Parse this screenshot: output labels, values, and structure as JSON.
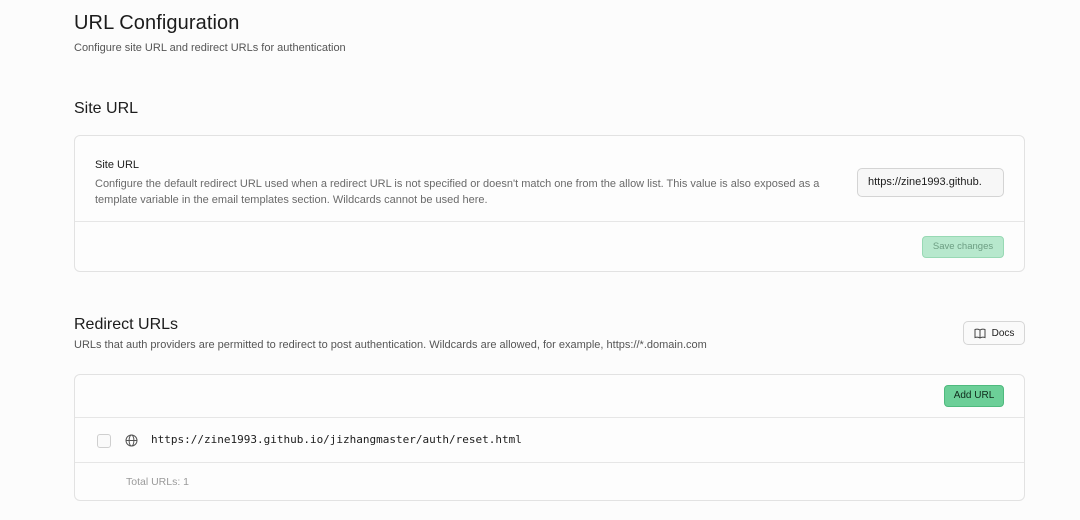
{
  "header": {
    "title": "URL Configuration",
    "subtitle": "Configure site URL and redirect URLs for authentication"
  },
  "site_url_section": {
    "title": "Site URL",
    "field_label": "Site URL",
    "field_help": "Configure the default redirect URL used when a redirect URL is not specified or doesn't match one from the allow list. This value is also exposed as a template variable in the email templates section. Wildcards cannot be used here.",
    "field_value": "https://zine1993.github.",
    "save_label": "Save changes"
  },
  "redirect_section": {
    "title": "Redirect URLs",
    "description": "URLs that auth providers are permitted to redirect to post authentication. Wildcards are allowed, for example, https://*.domain.com",
    "docs_label": "Docs",
    "docs_icon": "book-icon",
    "add_label": "Add URL",
    "urls": [
      {
        "url": "https://zine1993.github.io/jizhangmaster/auth/reset.html",
        "icon": "globe-icon"
      }
    ],
    "total_label": "Total URLs: 1"
  },
  "colors": {
    "primary_green": "#6ccf98",
    "disabled_green": "#b7e8cd",
    "border": "#e2e2e2"
  }
}
